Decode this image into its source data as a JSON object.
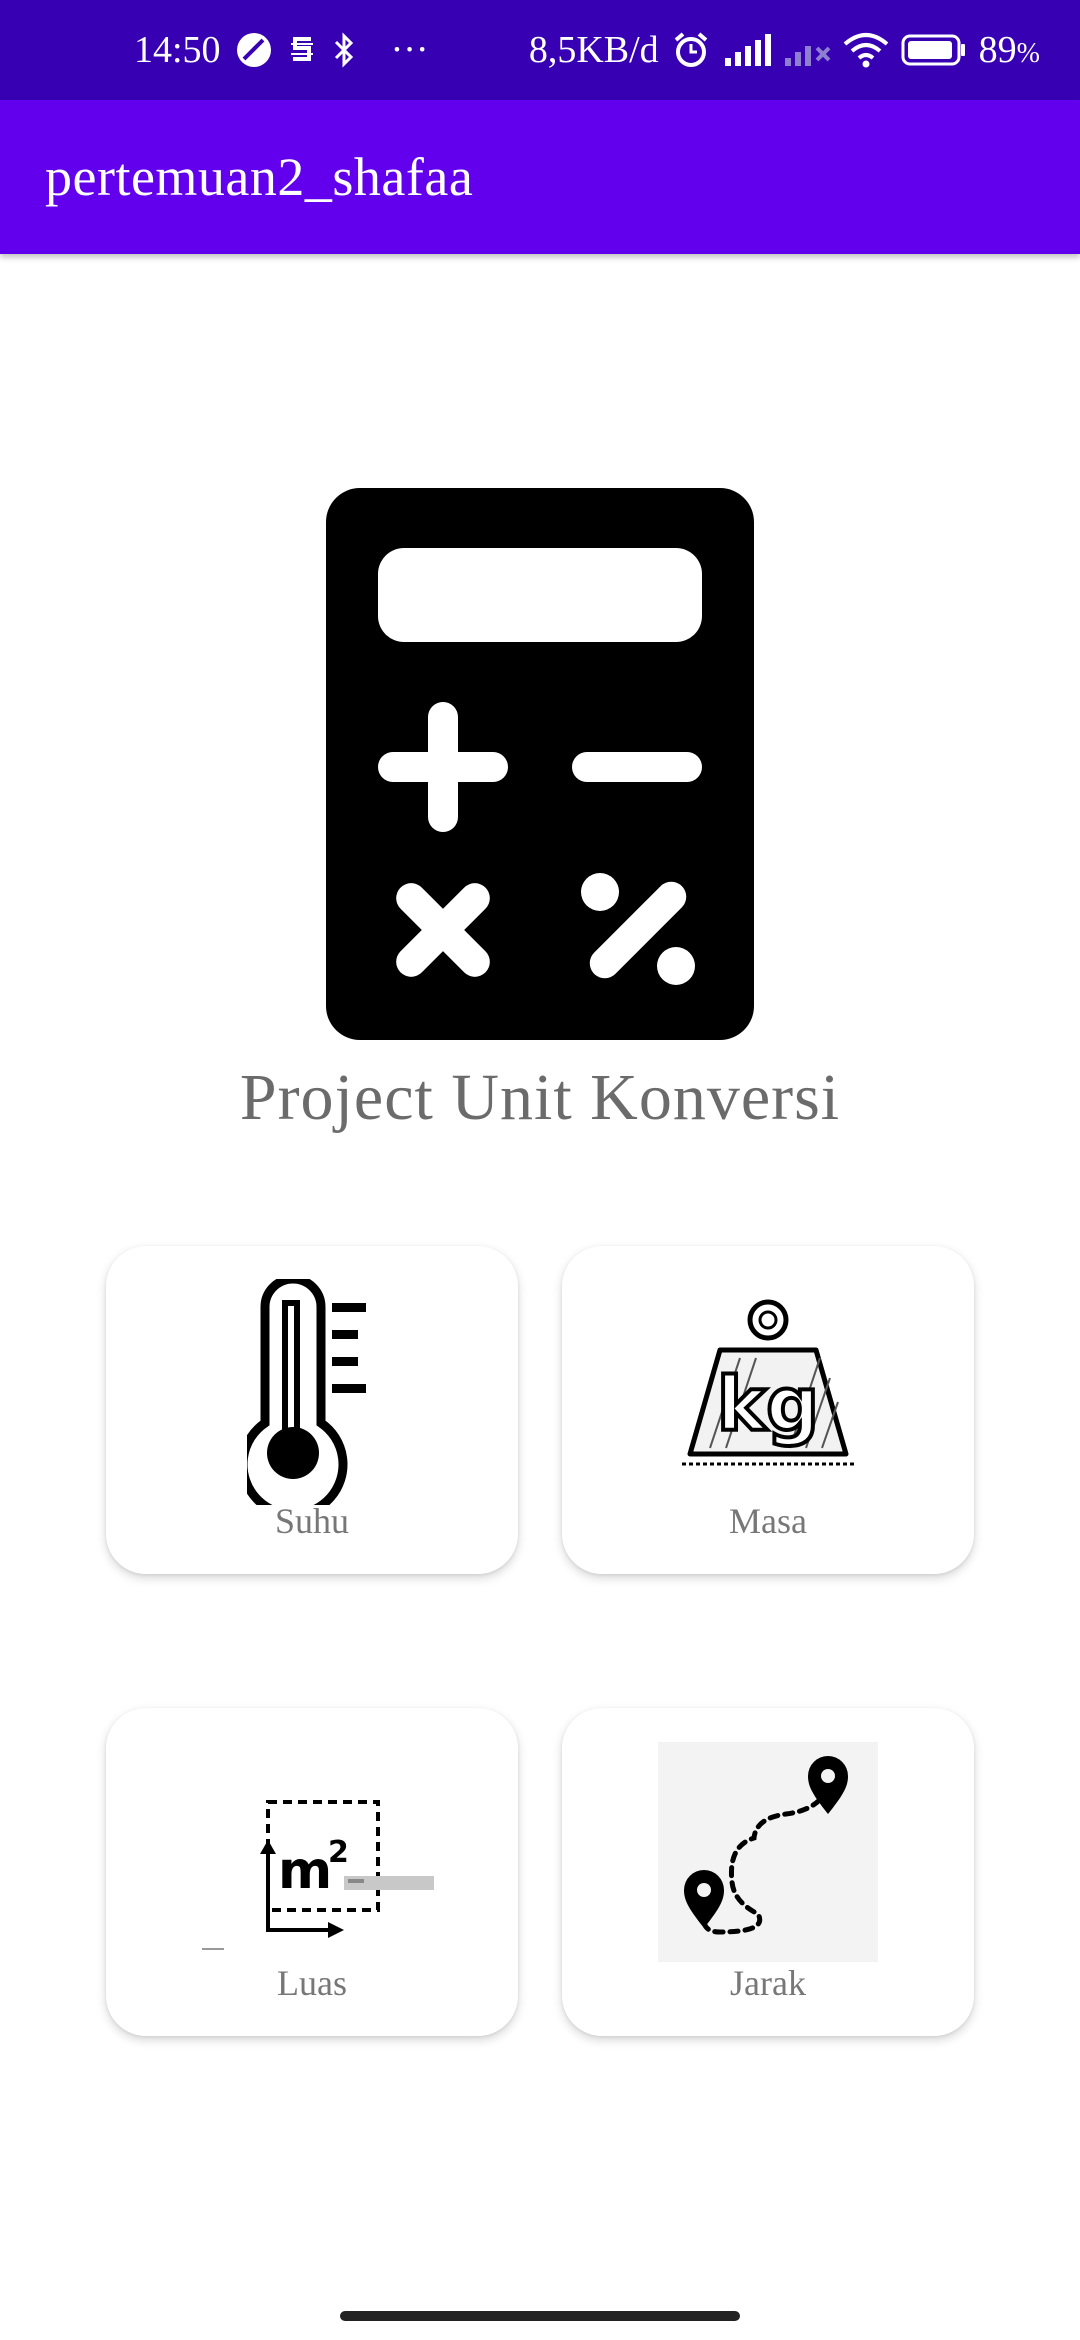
{
  "status_bar": {
    "time": "14:50",
    "network_speed": "8,5KB/d",
    "battery": "89",
    "battery_unit": "%",
    "more": "···"
  },
  "app_bar": {
    "title": "pertemuan2_shafaa"
  },
  "hero": {
    "title": "Project Unit Konversi",
    "icon": "calculator-icon"
  },
  "cards": [
    {
      "label": "Suhu",
      "icon": "thermometer-icon"
    },
    {
      "label": "Masa",
      "icon": "weight-kg-icon"
    },
    {
      "label": "Luas",
      "icon": "area-m2-icon",
      "icon_text": "m",
      "icon_sup": "2"
    },
    {
      "label": "Jarak",
      "icon": "route-pins-icon"
    }
  ],
  "colors": {
    "status_bar": "#3700b3",
    "app_bar": "#6200ee",
    "label_text": "#777777"
  }
}
